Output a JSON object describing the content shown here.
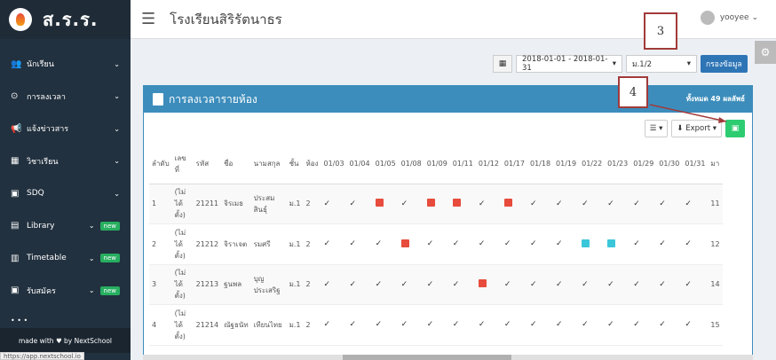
{
  "sidebar": {
    "logo": "ส.ร.ร.",
    "items": [
      {
        "label": "นักเรียน",
        "icon": "users-icon",
        "new": false
      },
      {
        "label": "การลงเวลา",
        "icon": "clock-icon",
        "new": false
      },
      {
        "label": "แจ้งข่าวสาร",
        "icon": "megaphone-icon",
        "new": false
      },
      {
        "label": "วิชาเรียน",
        "icon": "calendar-icon",
        "new": false
      },
      {
        "label": "SDQ",
        "icon": "clipboard-icon",
        "new": false
      },
      {
        "label": "Library",
        "icon": "book-icon",
        "new": true
      },
      {
        "label": "Timetable",
        "icon": "table-icon",
        "new": true
      },
      {
        "label": "รับสมัคร",
        "icon": "form-icon",
        "new": true
      }
    ],
    "new_label": "new",
    "footer": "made with ♥ by NextSchool"
  },
  "header": {
    "school_name": "โรงเรียนสิริรัตนาธร",
    "user": "yooyee"
  },
  "filters": {
    "date_range": "2018-01-01 - 2018-01-31",
    "class": "ม.1/2",
    "filter_button": "กรองข้อมูล"
  },
  "panel": {
    "title": "การลงเวลารายห้อง",
    "count": "ทั้งหมด 49 ผลลัพธ์",
    "export_label": "Export"
  },
  "table": {
    "headers": [
      "ลำดับ",
      "เลขที่",
      "รหัส",
      "ชื่อ",
      "นามสกุล",
      "ชั้น",
      "ห้อง",
      "01/03",
      "01/04",
      "01/05",
      "01/08",
      "01/09",
      "01/11",
      "01/12",
      "01/17",
      "01/18",
      "01/19",
      "01/22",
      "01/23",
      "01/29",
      "01/30",
      "01/31",
      "มา"
    ],
    "rows": [
      {
        "no": "1",
        "num": "(ไม่ได้ตั้ง)",
        "id": "21211",
        "first": "จิรเมธ",
        "last": "ประสมสินธุ์",
        "level": "ม.1",
        "room": "2",
        "marks": [
          "c",
          "c",
          "r",
          "c",
          "r",
          "r",
          "c",
          "r",
          "c",
          "c",
          "c",
          "c",
          "c",
          "c",
          "c"
        ],
        "total": "11"
      },
      {
        "no": "2",
        "num": "(ไม่ได้ตั้ง)",
        "id": "21212",
        "first": "จิราเจต",
        "last": "รมศรี",
        "level": "ม.1",
        "room": "2",
        "marks": [
          "c",
          "c",
          "c",
          "r",
          "c",
          "c",
          "c",
          "c",
          "c",
          "c",
          "b",
          "b",
          "c",
          "c",
          "c"
        ],
        "total": "12"
      },
      {
        "no": "3",
        "num": "(ไม่ได้ตั้ง)",
        "id": "21213",
        "first": "ฐนพล",
        "last": "บุญประเสริฐ",
        "level": "ม.1",
        "room": "2",
        "marks": [
          "c",
          "c",
          "c",
          "c",
          "c",
          "c",
          "r",
          "c",
          "c",
          "c",
          "c",
          "c",
          "c",
          "c",
          "c"
        ],
        "total": "14"
      },
      {
        "no": "4",
        "num": "(ไม่ได้ตั้ง)",
        "id": "21214",
        "first": "ณัฐธนัท",
        "last": "เทียนไทย",
        "level": "ม.1",
        "room": "2",
        "marks": [
          "c",
          "c",
          "c",
          "c",
          "c",
          "c",
          "c",
          "c",
          "c",
          "c",
          "c",
          "c",
          "c",
          "c",
          "c"
        ],
        "total": "15"
      }
    ]
  },
  "callouts": {
    "three": "3",
    "four": "4"
  },
  "status_url": "https://app.nextschool.io"
}
